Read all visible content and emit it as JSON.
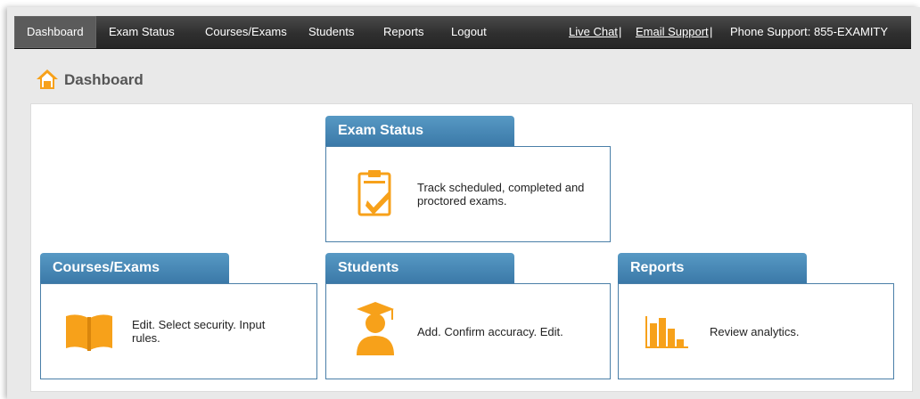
{
  "nav": {
    "items": [
      {
        "label": "Dashboard"
      },
      {
        "label": "Exam Status"
      },
      {
        "label": "Courses/Exams"
      },
      {
        "label": "Students"
      },
      {
        "label": "Reports"
      },
      {
        "label": "Logout"
      }
    ],
    "live_chat": "Live Chat",
    "email_support": "Email Support",
    "separator": "|",
    "phone_support": "Phone Support: 855-EXAMITY"
  },
  "page": {
    "title": "Dashboard",
    "icon": "home-icon"
  },
  "cards": {
    "exam_status": {
      "title": "Exam Status",
      "text": "Track scheduled, completed and proctored exams.",
      "icon": "clipboard-check-icon"
    },
    "courses_exams": {
      "title": "Courses/Exams",
      "text": "Edit. Select security. Input rules.",
      "icon": "open-book-icon"
    },
    "students": {
      "title": "Students",
      "text": "Add. Confirm accuracy. Edit.",
      "icon": "graduate-icon"
    },
    "reports": {
      "title": "Reports",
      "text": "Review analytics.",
      "icon": "bar-chart-icon"
    }
  },
  "colors": {
    "nav_bg": "#2f2f2f",
    "accent_blue": "#3b79a8",
    "icon_orange": "#f7a11a"
  }
}
